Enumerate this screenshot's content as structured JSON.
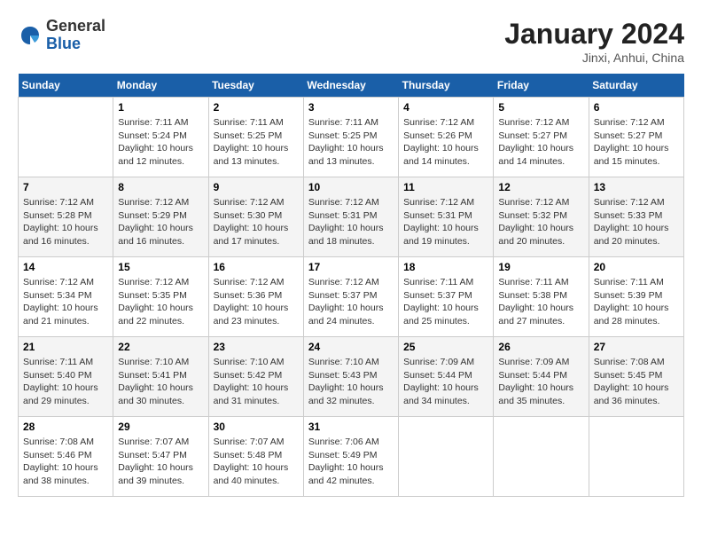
{
  "header": {
    "logo_general": "General",
    "logo_blue": "Blue",
    "month_year": "January 2024",
    "location": "Jinxi, Anhui, China"
  },
  "days_of_week": [
    "Sunday",
    "Monday",
    "Tuesday",
    "Wednesday",
    "Thursday",
    "Friday",
    "Saturday"
  ],
  "weeks": [
    [
      {
        "day": "",
        "sunrise": "",
        "sunset": "",
        "daylight": ""
      },
      {
        "day": "1",
        "sunrise": "7:11 AM",
        "sunset": "5:24 PM",
        "daylight": "10 hours and 12 minutes."
      },
      {
        "day": "2",
        "sunrise": "7:11 AM",
        "sunset": "5:25 PM",
        "daylight": "10 hours and 13 minutes."
      },
      {
        "day": "3",
        "sunrise": "7:11 AM",
        "sunset": "5:25 PM",
        "daylight": "10 hours and 13 minutes."
      },
      {
        "day": "4",
        "sunrise": "7:12 AM",
        "sunset": "5:26 PM",
        "daylight": "10 hours and 14 minutes."
      },
      {
        "day": "5",
        "sunrise": "7:12 AM",
        "sunset": "5:27 PM",
        "daylight": "10 hours and 14 minutes."
      },
      {
        "day": "6",
        "sunrise": "7:12 AM",
        "sunset": "5:27 PM",
        "daylight": "10 hours and 15 minutes."
      }
    ],
    [
      {
        "day": "7",
        "sunrise": "7:12 AM",
        "sunset": "5:28 PM",
        "daylight": "10 hours and 16 minutes."
      },
      {
        "day": "8",
        "sunrise": "7:12 AM",
        "sunset": "5:29 PM",
        "daylight": "10 hours and 16 minutes."
      },
      {
        "day": "9",
        "sunrise": "7:12 AM",
        "sunset": "5:30 PM",
        "daylight": "10 hours and 17 minutes."
      },
      {
        "day": "10",
        "sunrise": "7:12 AM",
        "sunset": "5:31 PM",
        "daylight": "10 hours and 18 minutes."
      },
      {
        "day": "11",
        "sunrise": "7:12 AM",
        "sunset": "5:31 PM",
        "daylight": "10 hours and 19 minutes."
      },
      {
        "day": "12",
        "sunrise": "7:12 AM",
        "sunset": "5:32 PM",
        "daylight": "10 hours and 20 minutes."
      },
      {
        "day": "13",
        "sunrise": "7:12 AM",
        "sunset": "5:33 PM",
        "daylight": "10 hours and 20 minutes."
      }
    ],
    [
      {
        "day": "14",
        "sunrise": "7:12 AM",
        "sunset": "5:34 PM",
        "daylight": "10 hours and 21 minutes."
      },
      {
        "day": "15",
        "sunrise": "7:12 AM",
        "sunset": "5:35 PM",
        "daylight": "10 hours and 22 minutes."
      },
      {
        "day": "16",
        "sunrise": "7:12 AM",
        "sunset": "5:36 PM",
        "daylight": "10 hours and 23 minutes."
      },
      {
        "day": "17",
        "sunrise": "7:12 AM",
        "sunset": "5:37 PM",
        "daylight": "10 hours and 24 minutes."
      },
      {
        "day": "18",
        "sunrise": "7:11 AM",
        "sunset": "5:37 PM",
        "daylight": "10 hours and 25 minutes."
      },
      {
        "day": "19",
        "sunrise": "7:11 AM",
        "sunset": "5:38 PM",
        "daylight": "10 hours and 27 minutes."
      },
      {
        "day": "20",
        "sunrise": "7:11 AM",
        "sunset": "5:39 PM",
        "daylight": "10 hours and 28 minutes."
      }
    ],
    [
      {
        "day": "21",
        "sunrise": "7:11 AM",
        "sunset": "5:40 PM",
        "daylight": "10 hours and 29 minutes."
      },
      {
        "day": "22",
        "sunrise": "7:10 AM",
        "sunset": "5:41 PM",
        "daylight": "10 hours and 30 minutes."
      },
      {
        "day": "23",
        "sunrise": "7:10 AM",
        "sunset": "5:42 PM",
        "daylight": "10 hours and 31 minutes."
      },
      {
        "day": "24",
        "sunrise": "7:10 AM",
        "sunset": "5:43 PM",
        "daylight": "10 hours and 32 minutes."
      },
      {
        "day": "25",
        "sunrise": "7:09 AM",
        "sunset": "5:44 PM",
        "daylight": "10 hours and 34 minutes."
      },
      {
        "day": "26",
        "sunrise": "7:09 AM",
        "sunset": "5:44 PM",
        "daylight": "10 hours and 35 minutes."
      },
      {
        "day": "27",
        "sunrise": "7:08 AM",
        "sunset": "5:45 PM",
        "daylight": "10 hours and 36 minutes."
      }
    ],
    [
      {
        "day": "28",
        "sunrise": "7:08 AM",
        "sunset": "5:46 PM",
        "daylight": "10 hours and 38 minutes."
      },
      {
        "day": "29",
        "sunrise": "7:07 AM",
        "sunset": "5:47 PM",
        "daylight": "10 hours and 39 minutes."
      },
      {
        "day": "30",
        "sunrise": "7:07 AM",
        "sunset": "5:48 PM",
        "daylight": "10 hours and 40 minutes."
      },
      {
        "day": "31",
        "sunrise": "7:06 AM",
        "sunset": "5:49 PM",
        "daylight": "10 hours and 42 minutes."
      },
      {
        "day": "",
        "sunrise": "",
        "sunset": "",
        "daylight": ""
      },
      {
        "day": "",
        "sunrise": "",
        "sunset": "",
        "daylight": ""
      },
      {
        "day": "",
        "sunrise": "",
        "sunset": "",
        "daylight": ""
      }
    ]
  ],
  "labels": {
    "sunrise_prefix": "Sunrise: ",
    "sunset_prefix": "Sunset: ",
    "daylight_prefix": "Daylight: "
  }
}
